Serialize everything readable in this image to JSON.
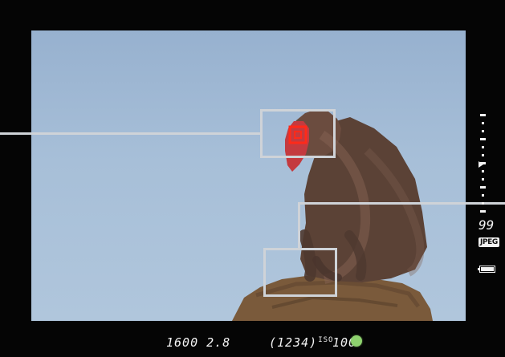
{
  "viewfinder": {
    "readout_left": "1600 2.8",
    "readout_middle": "(1234)",
    "iso_label": "ISO",
    "readout_right": "100",
    "shots_remaining": "99",
    "image_format": "JPEG",
    "battery_level": 1.0,
    "exposure_level_index": 0
  },
  "icons": {
    "af_point": "focus-point-icon",
    "focus_confirm": "focus-confirmation-dot",
    "battery": "battery-icon",
    "exposure_scale": "exposure-level-scale"
  },
  "colors": {
    "frame": "#050505",
    "lcd_text": "#f3f3f3",
    "af_point": "#ff2a1a",
    "focus_confirm": "#8ed26e",
    "callout": "#cfd3d8"
  }
}
